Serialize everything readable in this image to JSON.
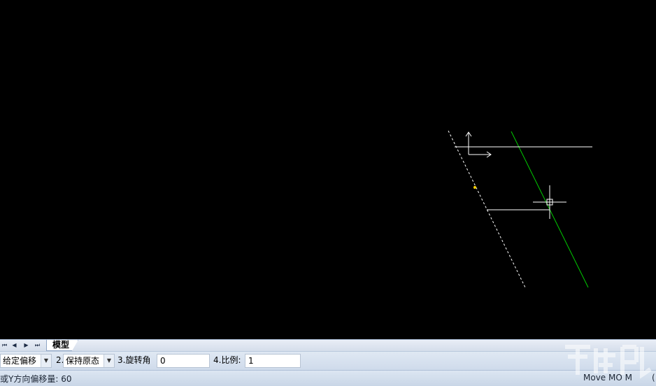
{
  "tabs": {
    "nav_first": "⏮",
    "nav_prev": "◀",
    "nav_next": "▶",
    "nav_last": "⏭",
    "model_tab": "模型"
  },
  "params": {
    "mode_value": "给定偏移",
    "label_2": "2.",
    "keep_value": "保持原态",
    "rotate_label": "3.旋转角",
    "rotate_value": "0",
    "scale_label": "4.比例:",
    "scale_value": "1"
  },
  "status": {
    "prompt": "或Y方向偏移量: 60",
    "command": "Move MO M",
    "extra": "("
  },
  "colors": {
    "canvas_bg": "#000000",
    "drawing_white": "#ffffff",
    "selected_green": "#00cc00",
    "grip_yellow": "#ffd200"
  }
}
